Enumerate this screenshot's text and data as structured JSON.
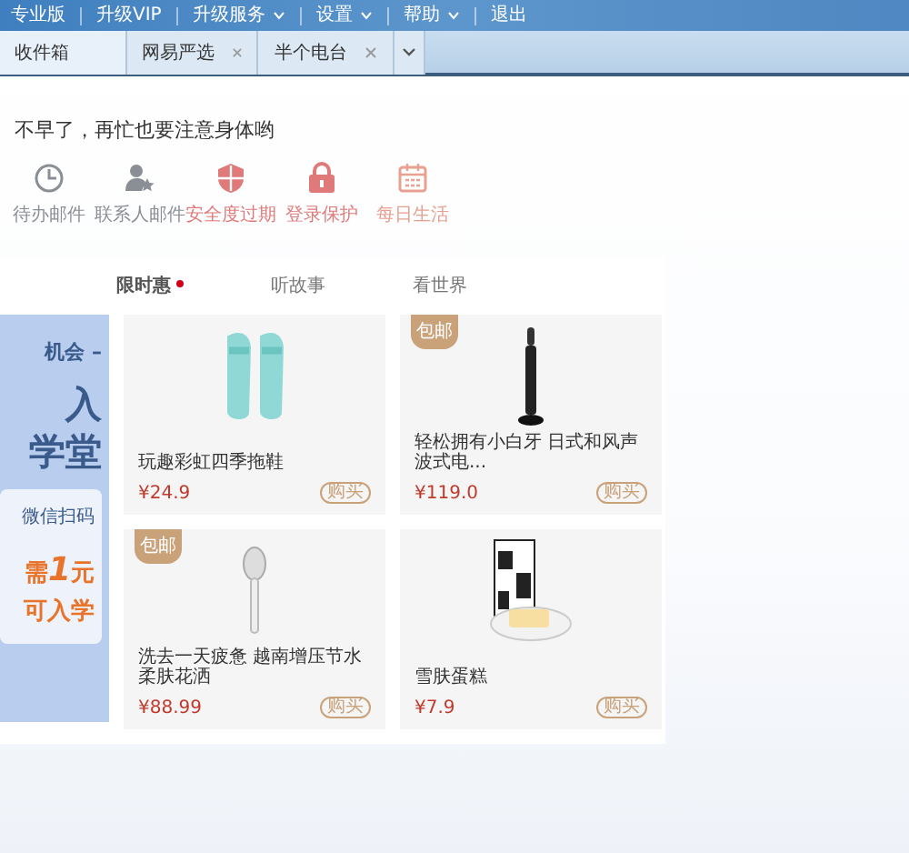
{
  "top_nav": [
    {
      "label": "专业版",
      "dropdown": false
    },
    {
      "label": "升级VIP",
      "dropdown": false
    },
    {
      "label": "升级服务",
      "dropdown": true
    },
    {
      "label": "设置",
      "dropdown": true
    },
    {
      "label": "帮助",
      "dropdown": true
    },
    {
      "label": "退出",
      "dropdown": false
    }
  ],
  "tabs": [
    {
      "label": "收件箱",
      "closable": false,
      "selected": true
    },
    {
      "label": "网易严选",
      "closable": true,
      "selected": false
    },
    {
      "label": "半个电台",
      "closable": true,
      "selected": false
    }
  ],
  "greeting": "不早了，再忙也要注意身体哟",
  "shortcuts": [
    {
      "kind": "clock",
      "label": "待办邮件",
      "color": "#8a8f96"
    },
    {
      "kind": "contact",
      "label": "联系人邮件",
      "color": "#8a8f96"
    },
    {
      "kind": "shield",
      "label": "安全度过期",
      "color": "#e07a7a"
    },
    {
      "kind": "lock",
      "label": "登录保护",
      "color": "#e07a7a"
    },
    {
      "kind": "calendar",
      "label": "每日生活",
      "color": "#e8a090"
    }
  ],
  "feed_tabs": [
    {
      "label": "限时惠",
      "selected": true,
      "dot": true
    },
    {
      "label": "听故事",
      "selected": false,
      "dot": false
    },
    {
      "label": "看世界",
      "selected": false,
      "dot": false
    }
  ],
  "banner": {
    "lines": [
      "机会 –",
      "入",
      "学堂"
    ],
    "scan": "微信扫码",
    "offer": {
      "before": "需",
      "number": "1",
      "after": "元",
      "second_line": "可入学"
    }
  },
  "products": [
    {
      "kind": "slippers",
      "name": "玩趣彩虹四季拖鞋",
      "price": "¥24.9",
      "buy": "购买",
      "free_shipping": false
    },
    {
      "kind": "toothbrush",
      "name": "轻松拥有小白牙 日式和风声波式电...",
      "price": "¥119.0",
      "buy": "购买",
      "free_shipping": true,
      "badge": "包邮"
    },
    {
      "kind": "showerhead",
      "name": "洗去一天疲惫 越南增压节水柔肤花洒",
      "price": "¥88.99",
      "buy": "购买",
      "free_shipping": true,
      "badge": "包邮"
    },
    {
      "kind": "cake",
      "name": "雪肤蛋糕",
      "price": "¥7.9",
      "buy": "购买",
      "free_shipping": false
    }
  ]
}
